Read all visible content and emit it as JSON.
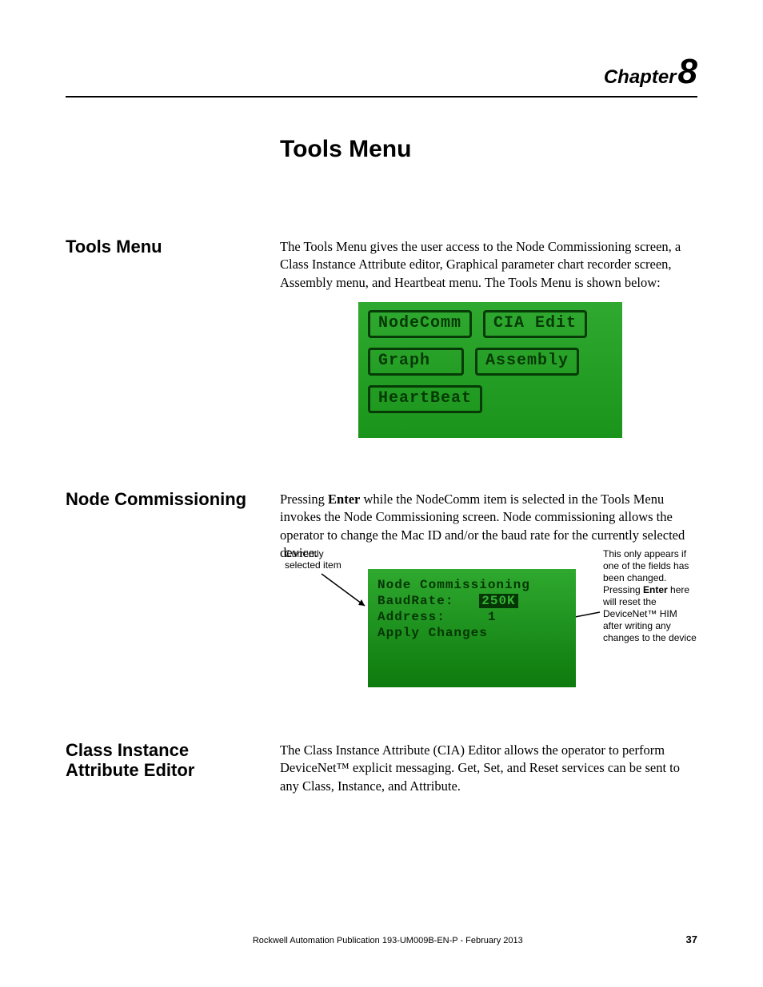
{
  "chapter": {
    "word": "Chapter",
    "number": "8"
  },
  "title": "Tools Menu",
  "sections": {
    "tools": {
      "heading": "Tools Menu",
      "body": "The Tools Menu gives the user access to the Node Commissioning screen, a Class Instance Attribute editor, Graphical parameter chart recorder screen, Assembly menu, and Heartbeat menu. The Tools Menu is shown below:"
    },
    "node": {
      "heading": "Node Commissioning",
      "body_pre": "Pressing ",
      "body_bold": "Enter",
      "body_post": " while the NodeComm item is selected in the Tools Menu invokes the Node Commissioning screen. Node commissioning allows the operator to change the Mac ID and/or the baud rate for the currently selected device."
    },
    "cia": {
      "heading": "Class Instance Attribute Editor",
      "body": "The Class Instance Attribute (CIA) Editor allows the operator to perform DeviceNet™ explicit messaging. Get, Set, and Reset services can be sent to any Class, Instance, and Attribute."
    }
  },
  "lcd_tools": {
    "btn1": "NodeComm",
    "btn2": "CIA Edit",
    "btn3": "Graph",
    "btn4": "Assembly",
    "btn5": "HeartBeat"
  },
  "lcd_node": {
    "title": "Node Commissioning",
    "baud_label": "BaudRate:",
    "baud_value": "250K",
    "addr_label": "Address:",
    "addr_value": "1",
    "apply": "Apply Changes"
  },
  "callouts": {
    "left": "Currently selected item",
    "right_pre": "This only appears if one of the fields has been changed. Pressing ",
    "right_bold": "Enter",
    "right_post": " here will reset the DeviceNet™ HIM after writing any changes to the device"
  },
  "footer": {
    "publication": "Rockwell Automation Publication 193-UM009B-EN-P - February 2013",
    "page": "37"
  }
}
